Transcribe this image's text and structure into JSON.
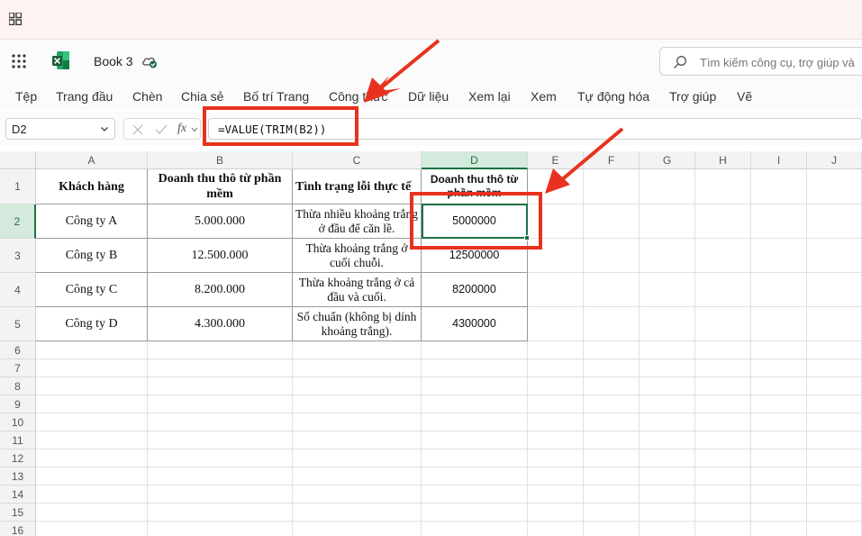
{
  "app": {
    "title": "Book 3",
    "search_placeholder": "Tìm kiếm công cụ, trợ giúp và"
  },
  "menu": [
    "Tệp",
    "Trang đầu",
    "Chèn",
    "Chia sẻ",
    "Bố trí Trang",
    "Công thức",
    "Dữ liệu",
    "Xem lại",
    "Xem",
    "Tự động hóa",
    "Trợ giúp",
    "Vẽ"
  ],
  "formula_bar": {
    "name_box": "D2",
    "fx_label": "fx",
    "formula": "=VALUE(TRIM(B2))"
  },
  "columns": [
    "A",
    "B",
    "C",
    "D",
    "E",
    "F",
    "G",
    "H",
    "I",
    "J"
  ],
  "rows": [
    "1",
    "2",
    "3",
    "4",
    "5",
    "6",
    "7",
    "8",
    "9",
    "10",
    "11",
    "12",
    "13",
    "14",
    "15",
    "16"
  ],
  "table": {
    "headers": [
      "Khách hàng",
      "Doanh thu thô từ phần mềm",
      "Tình trạng lỗi thực tế",
      "Doanh thu thô từ phần mềm"
    ],
    "rows": [
      [
        "Công ty A",
        "5.000.000",
        "Thừa nhiều khoảng trắng ở đầu để căn lề.",
        "5000000"
      ],
      [
        "Công ty B",
        "12.500.000",
        "Thừa khoảng trắng ở cuối chuỗi.",
        "12500000"
      ],
      [
        "Công ty C",
        "8.200.000",
        "Thừa khoảng trắng ở cả đầu và cuối.",
        "8200000"
      ],
      [
        "Công ty D",
        "4.300.000",
        "Số chuẩn (không bị dính khoảng trắng).",
        "4300000"
      ]
    ]
  },
  "selected_cell": "D2",
  "colors": {
    "excel_green": "#1e7145",
    "annotation_red": "#e8321f"
  }
}
